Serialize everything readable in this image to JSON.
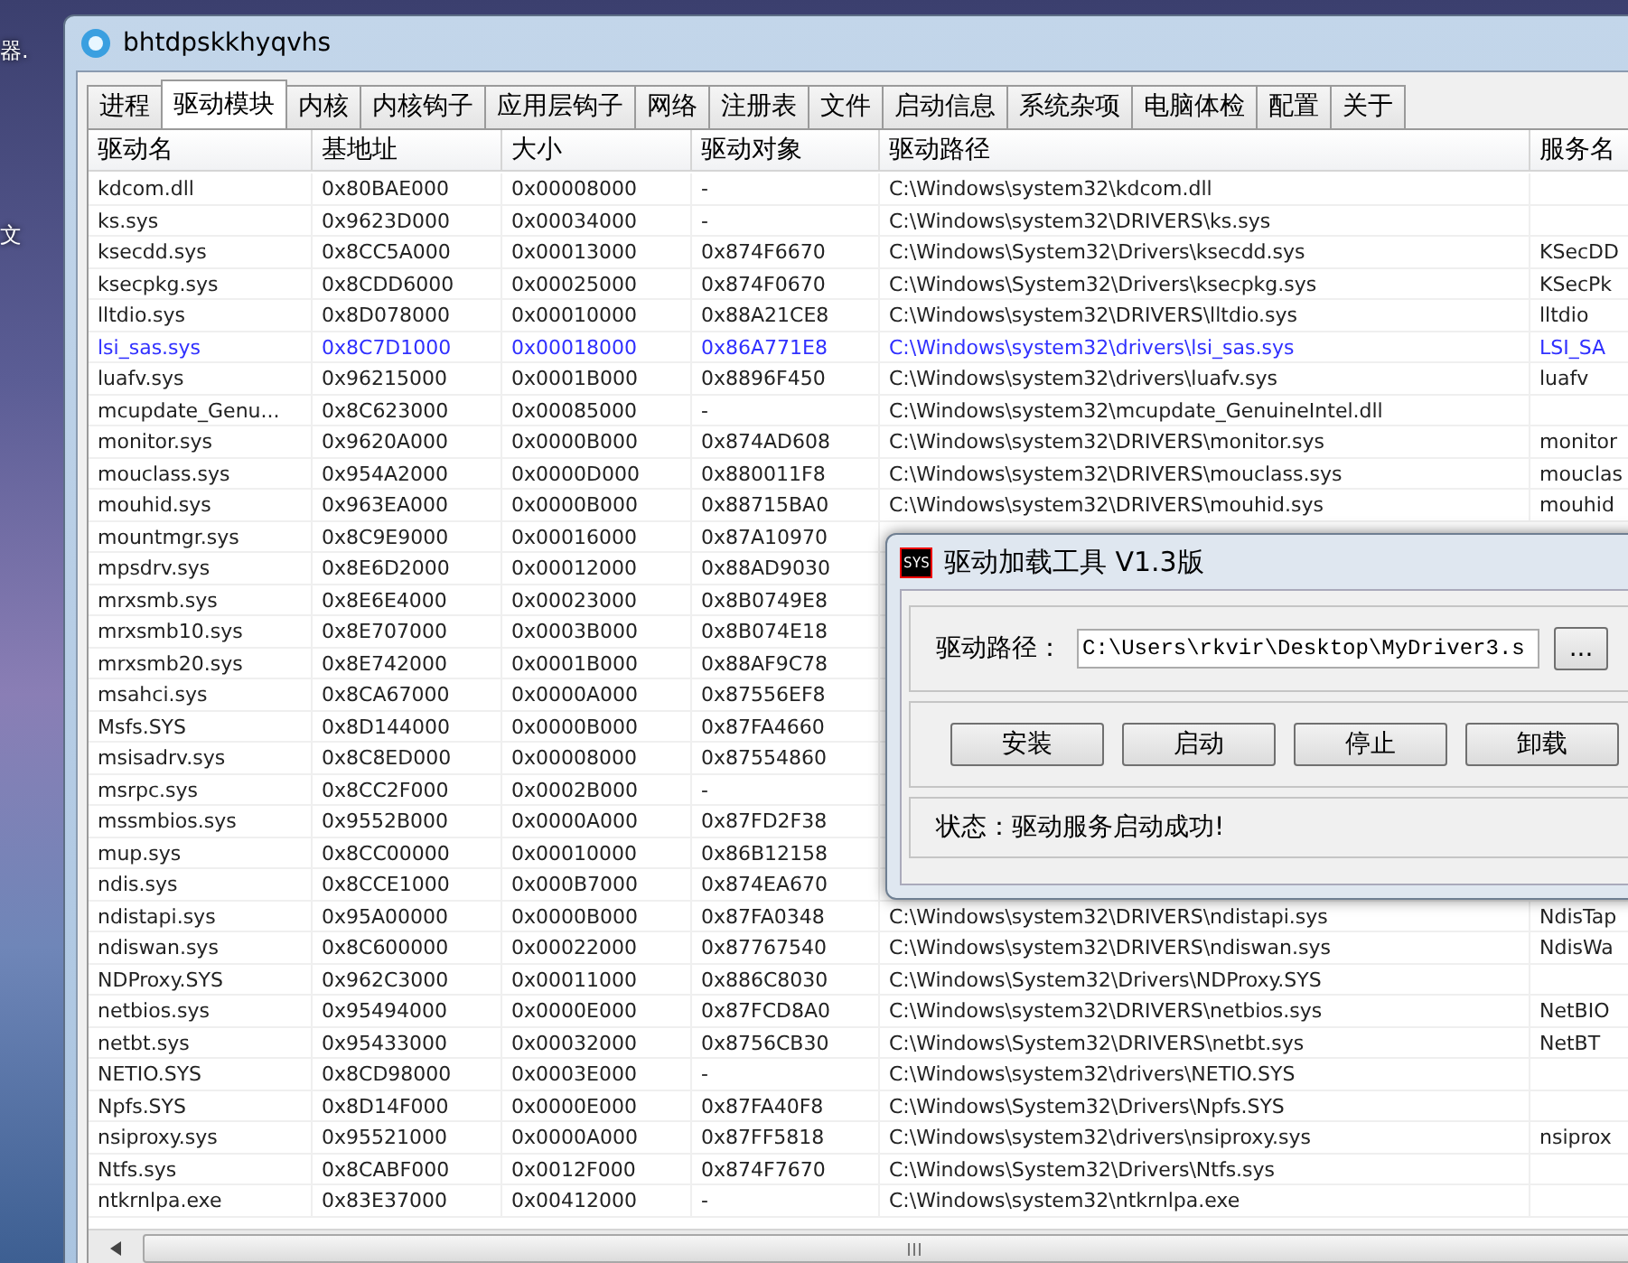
{
  "desktop_labels": [
    "器.",
    "文"
  ],
  "window": {
    "title": "bhtdpskkhyqvhs"
  },
  "tabs": [
    {
      "label": "进程",
      "selected": false
    },
    {
      "label": "驱动模块",
      "selected": true
    },
    {
      "label": "内核",
      "selected": false
    },
    {
      "label": "内核钩子",
      "selected": false
    },
    {
      "label": "应用层钩子",
      "selected": false
    },
    {
      "label": "网络",
      "selected": false
    },
    {
      "label": "注册表",
      "selected": false
    },
    {
      "label": "文件",
      "selected": false
    },
    {
      "label": "启动信息",
      "selected": false
    },
    {
      "label": "系统杂项",
      "selected": false
    },
    {
      "label": "电脑体检",
      "selected": false
    },
    {
      "label": "配置",
      "selected": false
    },
    {
      "label": "关于",
      "selected": false
    }
  ],
  "table": {
    "columns": [
      "驱动名",
      "基地址",
      "大小",
      "驱动对象",
      "驱动路径",
      "服务名"
    ],
    "rows": [
      {
        "name": "kdcom.dll",
        "base": "0x80BAE000",
        "size": "0x00008000",
        "object": "-",
        "path": "C:\\Windows\\system32\\kdcom.dll",
        "highlighted": false
      },
      {
        "name": "ks.sys",
        "base": "0x9623D000",
        "size": "0x00034000",
        "object": "-",
        "path": "C:\\Windows\\system32\\DRIVERS\\ks.sys",
        "highlighted": false
      },
      {
        "name": "ksecdd.sys",
        "base": "0x8CC5A000",
        "size": "0x00013000",
        "object": "0x874F6670",
        "path": "C:\\Windows\\System32\\Drivers\\ksecdd.sys",
        "service": "KSecDD",
        "highlighted": false
      },
      {
        "name": "ksecpkg.sys",
        "base": "0x8CDD6000",
        "size": "0x00025000",
        "object": "0x874F0670",
        "path": "C:\\Windows\\System32\\Drivers\\ksecpkg.sys",
        "service": "KSecPk",
        "highlighted": false
      },
      {
        "name": "lltdio.sys",
        "base": "0x8D078000",
        "size": "0x00010000",
        "object": "0x88A21CE8",
        "path": "C:\\Windows\\system32\\DRIVERS\\lltdio.sys",
        "service": "lltdio",
        "highlighted": false
      },
      {
        "name": "lsi_sas.sys",
        "base": "0x8C7D1000",
        "size": "0x00018000",
        "object": "0x86A771E8",
        "path": "C:\\Windows\\system32\\drivers\\lsi_sas.sys",
        "service": "LSI_SA",
        "highlighted": true
      },
      {
        "name": "luafv.sys",
        "base": "0x96215000",
        "size": "0x0001B000",
        "object": "0x8896F450",
        "path": "C:\\Windows\\system32\\drivers\\luafv.sys",
        "service": "luafv",
        "highlighted": false
      },
      {
        "name": "mcupdate_Genu...",
        "base": "0x8C623000",
        "size": "0x00085000",
        "object": "-",
        "path": "C:\\Windows\\system32\\mcupdate_GenuineIntel.dll",
        "highlighted": false
      },
      {
        "name": "monitor.sys",
        "base": "0x9620A000",
        "size": "0x0000B000",
        "object": "0x874AD608",
        "path": "C:\\Windows\\system32\\DRIVERS\\monitor.sys",
        "service": "monitor",
        "highlighted": false
      },
      {
        "name": "mouclass.sys",
        "base": "0x954A2000",
        "size": "0x0000D000",
        "object": "0x880011F8",
        "path": "C:\\Windows\\system32\\DRIVERS\\mouclass.sys",
        "service": "mouclas",
        "highlighted": false
      },
      {
        "name": "mouhid.sys",
        "base": "0x963EA000",
        "size": "0x0000B000",
        "object": "0x88715BA0",
        "path": "C:\\Windows\\system32\\DRIVERS\\mouhid.sys",
        "service": "mouhid",
        "highlighted": false
      },
      {
        "name": "mountmgr.sys",
        "base": "0x8C9E9000",
        "size": "0x00016000",
        "object": "0x87A10970",
        "highlighted": false
      },
      {
        "name": "mpsdrv.sys",
        "base": "0x8E6D2000",
        "size": "0x00012000",
        "object": "0x88AD9030",
        "highlighted": false
      },
      {
        "name": "mrxsmb.sys",
        "base": "0x8E6E4000",
        "size": "0x00023000",
        "object": "0x8B0749E8",
        "highlighted": false
      },
      {
        "name": "mrxsmb10.sys",
        "base": "0x8E707000",
        "size": "0x0003B000",
        "object": "0x8B074E18",
        "highlighted": false
      },
      {
        "name": "mrxsmb20.sys",
        "base": "0x8E742000",
        "size": "0x0001B000",
        "object": "0x88AF9C78",
        "highlighted": false
      },
      {
        "name": "msahci.sys",
        "base": "0x8CA67000",
        "size": "0x0000A000",
        "object": "0x87556EF8",
        "highlighted": false
      },
      {
        "name": "Msfs.SYS",
        "base": "0x8D144000",
        "size": "0x0000B000",
        "object": "0x87FA4660",
        "highlighted": false
      },
      {
        "name": "msisadrv.sys",
        "base": "0x8C8ED000",
        "size": "0x00008000",
        "object": "0x87554860",
        "highlighted": false
      },
      {
        "name": "msrpc.sys",
        "base": "0x8CC2F000",
        "size": "0x0002B000",
        "object": "-",
        "highlighted": false
      },
      {
        "name": "mssmbios.sys",
        "base": "0x9552B000",
        "size": "0x0000A000",
        "object": "0x87FD2F38",
        "highlighted": false
      },
      {
        "name": "mup.sys",
        "base": "0x8CC00000",
        "size": "0x00010000",
        "object": "0x86B12158",
        "highlighted": false
      },
      {
        "name": "ndis.sys",
        "base": "0x8CCE1000",
        "size": "0x000B7000",
        "object": "0x874EA670",
        "highlighted": false
      },
      {
        "name": "ndistapi.sys",
        "base": "0x95A00000",
        "size": "0x0000B000",
        "object": "0x87FA0348",
        "path": "C:\\Windows\\system32\\DRIVERS\\ndistapi.sys",
        "service": "NdisTap",
        "highlighted": false
      },
      {
        "name": "ndiswan.sys",
        "base": "0x8C600000",
        "size": "0x00022000",
        "object": "0x87767540",
        "path": "C:\\Windows\\system32\\DRIVERS\\ndiswan.sys",
        "service": "NdisWa",
        "highlighted": false
      },
      {
        "name": "NDProxy.SYS",
        "base": "0x962C3000",
        "size": "0x00011000",
        "object": "0x886C8030",
        "path": "C:\\Windows\\System32\\Drivers\\NDProxy.SYS",
        "highlighted": false
      },
      {
        "name": "netbios.sys",
        "base": "0x95494000",
        "size": "0x0000E000",
        "object": "0x87FCD8A0",
        "path": "C:\\Windows\\system32\\DRIVERS\\netbios.sys",
        "service": "NetBIO",
        "highlighted": false
      },
      {
        "name": "netbt.sys",
        "base": "0x95433000",
        "size": "0x00032000",
        "object": "0x8756CB30",
        "path": "C:\\Windows\\System32\\DRIVERS\\netbt.sys",
        "service": "NetBT",
        "highlighted": false
      },
      {
        "name": "NETIO.SYS",
        "base": "0x8CD98000",
        "size": "0x0003E000",
        "object": "-",
        "path": "C:\\Windows\\system32\\drivers\\NETIO.SYS",
        "highlighted": false
      },
      {
        "name": "Npfs.SYS",
        "base": "0x8D14F000",
        "size": "0x0000E000",
        "object": "0x87FA40F8",
        "path": "C:\\Windows\\System32\\Drivers\\Npfs.SYS",
        "highlighted": false
      },
      {
        "name": "nsiproxy.sys",
        "base": "0x95521000",
        "size": "0x0000A000",
        "object": "0x87FF5818",
        "path": "C:\\Windows\\system32\\drivers\\nsiproxy.sys",
        "service": "nsiprox",
        "highlighted": false
      },
      {
        "name": "Ntfs.sys",
        "base": "0x8CABF000",
        "size": "0x0012F000",
        "object": "0x874F7670",
        "path": "C:\\Windows\\System32\\Drivers\\Ntfs.sys",
        "highlighted": false
      },
      {
        "name": "ntkrnlpa.exe",
        "base": "0x83E37000",
        "size": "0x00412000",
        "object": "-",
        "path": "C:\\Windows\\system32\\ntkrnlpa.exe",
        "highlighted": false
      }
    ]
  },
  "dialog": {
    "icon_text": "SYS",
    "title": "驱动加载工具 V1.3版",
    "path_label": "驱动路径：",
    "path_value": "C:\\Users\\rkvir\\Desktop\\MyDriver3.s",
    "browse_label": "...",
    "buttons": [
      "安装",
      "启动",
      "停止",
      "卸载"
    ],
    "status": "状态：驱动服务启动成功!"
  }
}
